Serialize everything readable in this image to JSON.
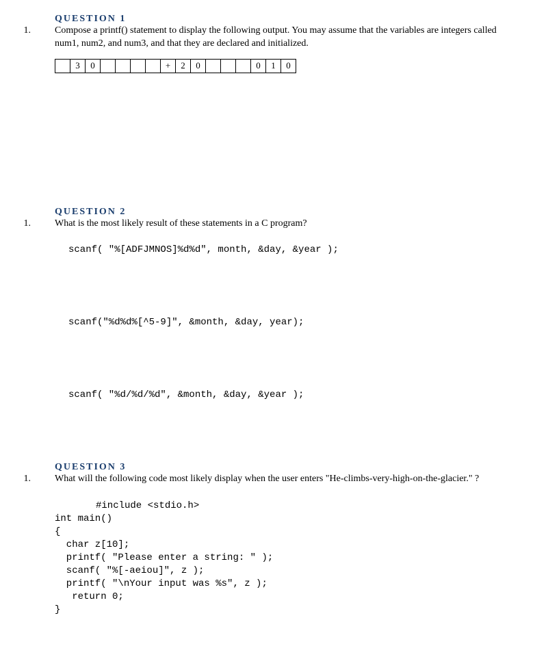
{
  "q1": {
    "title": "QUESTION 1",
    "number": "1.",
    "prompt": "Compose a printf() statement to display the following output.  You may assume that the variables are integers called num1, num2, and num3, and that they are declared and initialized.",
    "cells": [
      "",
      "3",
      "0",
      "",
      "",
      "",
      "",
      "+",
      "2",
      "0",
      "",
      "",
      "",
      "0",
      "1",
      "0"
    ]
  },
  "q2": {
    "title": "QUESTION 2",
    "number": "1.",
    "prompt": "What is the most likely result of these statements in  a C program?",
    "code1": "scanf( \"%[ADFJMNOS]%d%d\", month, &day, &year );",
    "code2": "scanf(\"%d%d%[^5-9]\", &month, &day, year);",
    "code3": "scanf( \"%d/%d/%d\", &month, &day, &year );"
  },
  "q3": {
    "title": "QUESTION 3",
    "number": "1.",
    "prompt": "What will the following code most likely display when the user enters \"He-climbs-very-high-on-the-glacier.\" ?",
    "code": {
      "l1": "#include <stdio.h>",
      "l2": "int main()",
      "l3": "{",
      "l4": "  char z[10];",
      "l5": "  printf( \"Please enter a string: \" );",
      "l6": "  scanf( \"%[-aeiou]\", z );",
      "l7": "  printf( \"\\nYour input was %s\", z );",
      "l8": "   return 0;",
      "l9": "}"
    }
  }
}
